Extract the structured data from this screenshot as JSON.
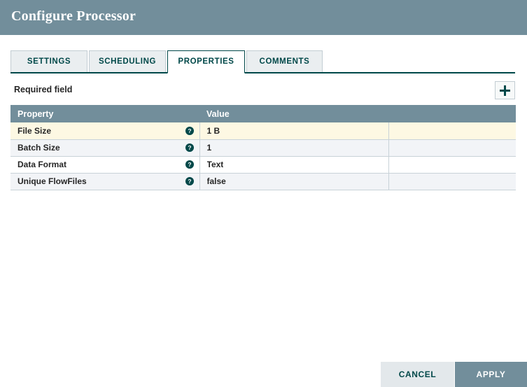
{
  "header": {
    "title": "Configure Processor",
    "background_color": "#728e9b"
  },
  "tabs": [
    {
      "label": "SETTINGS",
      "active": false
    },
    {
      "label": "SCHEDULING",
      "active": false
    },
    {
      "label": "PROPERTIES",
      "active": true
    },
    {
      "label": "COMMENTS",
      "active": false
    }
  ],
  "toolbar": {
    "required_field_label": "Required field",
    "add_property_icon": "plus-icon",
    "add_property_title": "Add Property"
  },
  "properties_table": {
    "columns": [
      "Property",
      "Value",
      ""
    ],
    "help_icon": "help-circle-icon",
    "rows": [
      {
        "property": "File Size",
        "value": "1 B",
        "required": true,
        "extra": ""
      },
      {
        "property": "Batch Size",
        "value": "1",
        "required": false,
        "extra": ""
      },
      {
        "property": "Data Format",
        "value": "Text",
        "required": false,
        "extra": ""
      },
      {
        "property": "Unique FlowFiles",
        "value": "false",
        "required": false,
        "extra": ""
      }
    ]
  },
  "footer": {
    "cancel_label": "CANCEL",
    "apply_label": "APPLY"
  },
  "colors": {
    "header": "#728e9b",
    "accent": "#004849",
    "table_header": "#728e9b",
    "required_row": "#fdf8e3",
    "alt_row": "#f2f4f7",
    "border": "#c8d2d8"
  }
}
